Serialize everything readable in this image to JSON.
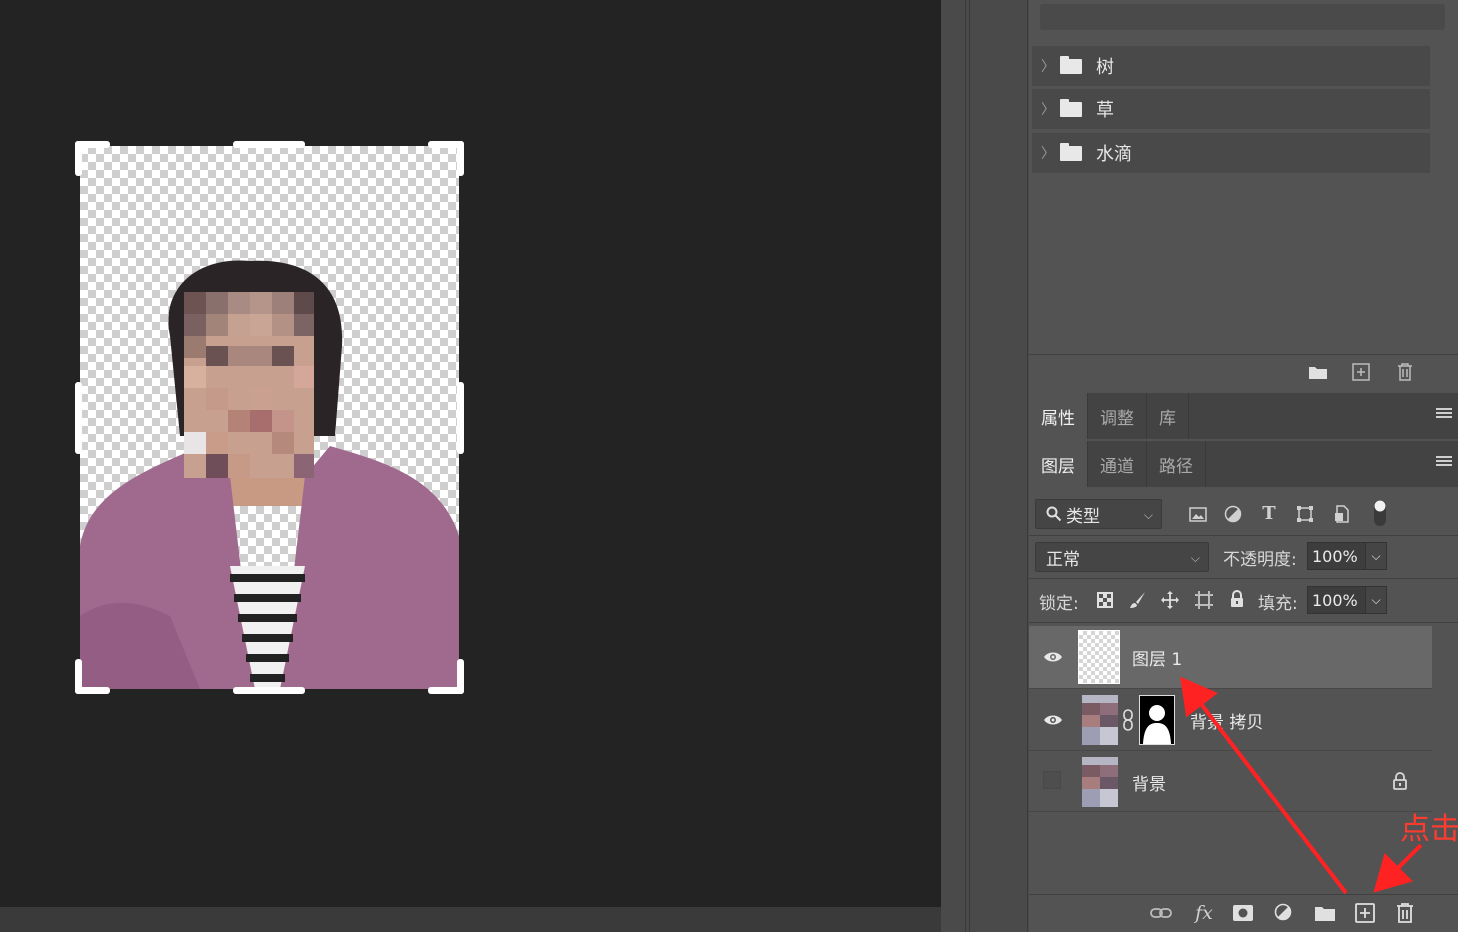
{
  "colors": {
    "canvas_bg": "#232323",
    "panel_bg": "#535353",
    "annotation": "#ff2222"
  },
  "preset_groups": [
    {
      "label": "树",
      "icon": "folder-icon"
    },
    {
      "label": "草",
      "icon": "folder-icon"
    },
    {
      "label": "水滴",
      "icon": "folder-icon"
    }
  ],
  "panel_footer_icons": [
    "new-group-icon",
    "new-item-icon",
    "trash-icon"
  ],
  "props_tabs": [
    {
      "label": "属性",
      "active": true
    },
    {
      "label": "调整",
      "active": false
    },
    {
      "label": "库",
      "active": false
    }
  ],
  "layer_tabs": [
    {
      "label": "图层",
      "active": true
    },
    {
      "label": "通道",
      "active": false
    },
    {
      "label": "路径",
      "active": false
    }
  ],
  "filter": {
    "kind_label": "类型"
  },
  "blend": {
    "mode": "正常",
    "opacity_label": "不透明度:",
    "opacity_value": "100%"
  },
  "lock": {
    "label": "锁定:",
    "fill_label": "填充:",
    "fill_value": "100%"
  },
  "layers": [
    {
      "name": "图层 1",
      "visible": true,
      "selected": true
    },
    {
      "name": "背景 拷贝",
      "visible": true,
      "selected": false,
      "has_mask": true
    },
    {
      "name": "背景",
      "visible": false,
      "selected": false,
      "locked": true
    }
  ],
  "bottom_toolbar_icons": [
    "link-icon",
    "fx-icon",
    "mask-icon",
    "adjustment-icon",
    "group-folder-icon",
    "new-layer-icon",
    "trash-icon"
  ],
  "annotation": {
    "text": "点击"
  }
}
